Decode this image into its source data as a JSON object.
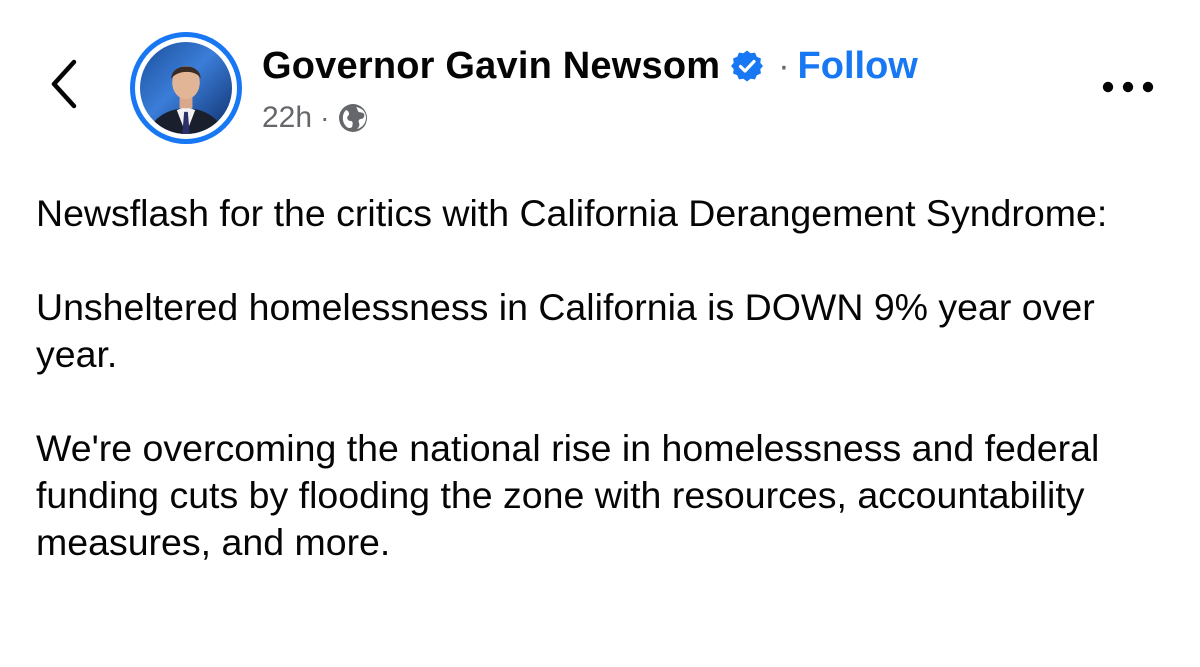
{
  "header": {
    "back_icon": "chevron-left-icon",
    "author_name": "Governor Gavin Newsom",
    "verified_icon": "verified-badge-icon",
    "separator": "·",
    "follow_label": "Follow",
    "timestamp": "22h",
    "meta_separator": "·",
    "audience_icon": "globe-icon",
    "more_icon": "more-horizontal-icon"
  },
  "post": {
    "paragraphs": [
      "Newsflash for the critics with California Derangement Syndrome:",
      "Unsheltered homelessness in California is DOWN 9% year over year.",
      "We're overcoming the national rise in homelessness and federal funding cuts by flooding the zone with resources, accountability measures, and more."
    ]
  },
  "colors": {
    "accent": "#1877f2",
    "secondary_text": "#65676b",
    "primary_text": "#050505"
  }
}
